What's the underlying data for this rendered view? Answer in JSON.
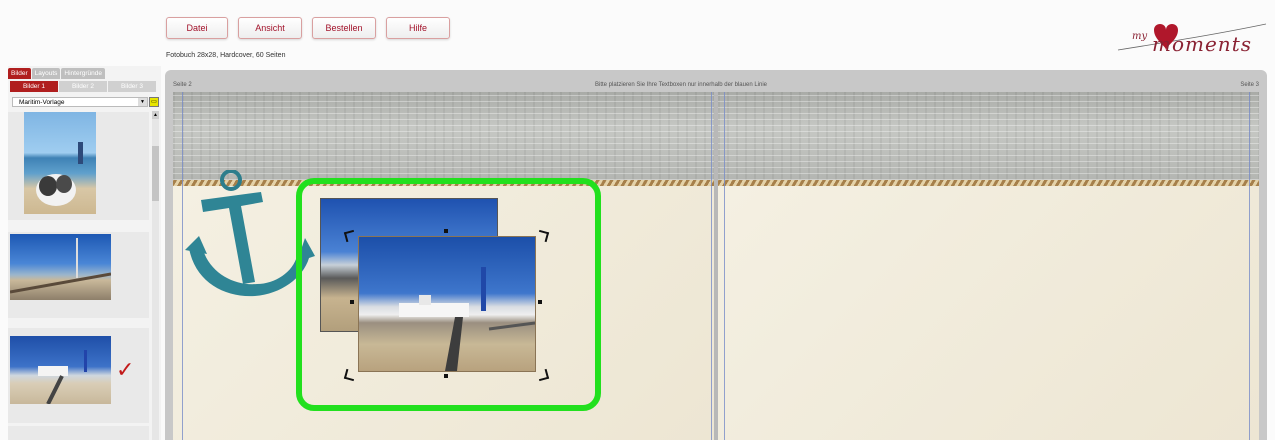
{
  "menu": {
    "items": [
      "Datei",
      "Ansicht",
      "Bestellen",
      "Hilfe"
    ]
  },
  "subtitle": "Fotobuch 28x28, Hardcover, 60 Seiten",
  "logo": {
    "small": "my",
    "script": "moments",
    "accent": "#b0172b"
  },
  "sidebar": {
    "tabs": [
      "Bilder",
      "Layouts",
      "Hintergründe"
    ],
    "subtabs": [
      "Bilder 1",
      "Bilder 2",
      "Bilder 3"
    ],
    "select_value": "Maritim-Vorlage"
  },
  "canvas": {
    "left_page_label": "Seite 2",
    "right_page_label": "Seite 3",
    "hint": "Bitte platzieren Sie Ihre Textboxen nur innerhalb der blauen Linie"
  },
  "colors": {
    "brand": "#b01e1e",
    "highlight": "#22e01e",
    "check": "#c21a1a"
  }
}
